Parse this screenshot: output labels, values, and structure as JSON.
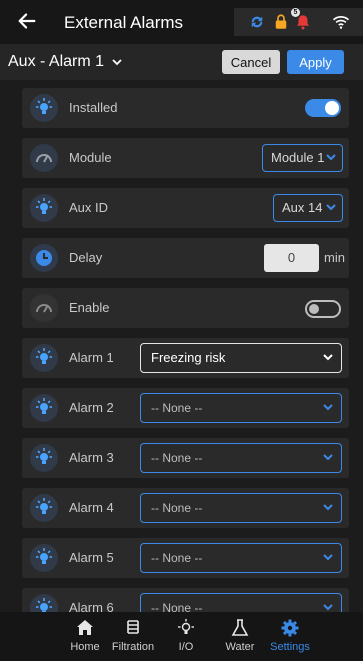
{
  "header": {
    "title": "External Alarms",
    "notification_count": "5"
  },
  "subbar": {
    "title": "Aux - Alarm 1",
    "cancel_label": "Cancel",
    "apply_label": "Apply"
  },
  "settings": {
    "installed": {
      "label": "Installed",
      "state": "on"
    },
    "module": {
      "label": "Module",
      "value": "Module 1"
    },
    "aux_id": {
      "label": "Aux ID",
      "value": "Aux 14"
    },
    "delay": {
      "label": "Delay",
      "value": "0",
      "unit": "min"
    },
    "enable": {
      "label": "Enable",
      "state": "off"
    }
  },
  "alarms": [
    {
      "label": "Alarm 1",
      "value": "Freezing risk"
    },
    {
      "label": "Alarm 2",
      "value": "-- None --"
    },
    {
      "label": "Alarm 3",
      "value": "-- None --"
    },
    {
      "label": "Alarm 4",
      "value": "-- None --"
    },
    {
      "label": "Alarm 5",
      "value": "-- None --"
    },
    {
      "label": "Alarm 6",
      "value": "-- None --"
    }
  ],
  "nav": [
    {
      "label": "Home",
      "icon": "home-icon"
    },
    {
      "label": "Filtration",
      "icon": "filtration-icon"
    },
    {
      "label": "I/O",
      "icon": "lightbulb-icon"
    },
    {
      "label": "Water",
      "icon": "flask-icon"
    },
    {
      "label": "Settings",
      "icon": "gear-icon",
      "active": true
    }
  ],
  "colors": {
    "accent": "#3b8ae8",
    "background": "#1e1e1e",
    "row": "#2a2a2a",
    "bulb": "#4aa3ff",
    "lock": "#f5a623",
    "bell": "#e53935"
  }
}
